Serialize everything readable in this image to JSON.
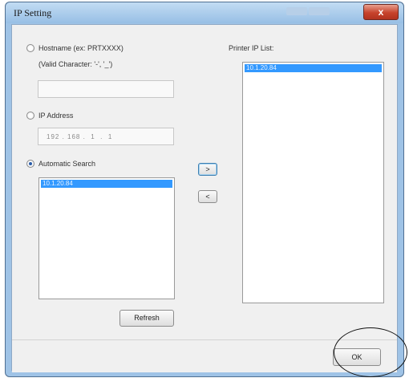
{
  "window": {
    "title": "IP Setting",
    "close_glyph": "x"
  },
  "left": {
    "hostname_label": "Hostname (ex: PRTXXXX)",
    "valid_chars_label": "(Valid Character: '-', '_')",
    "hostname_value": "",
    "ip_label": "IP Address",
    "ip_value": "192 . 168 .  1  .  1",
    "auto_label": "Automatic Search",
    "auto_list_items": [
      "10.1.20.84"
    ],
    "refresh_label": "Refresh"
  },
  "middle": {
    "add_label": ">",
    "remove_label": "<"
  },
  "right": {
    "list_label": "Printer IP List:",
    "list_items": [
      "10.1.20.84"
    ]
  },
  "footer": {
    "ok_label": "OK"
  }
}
